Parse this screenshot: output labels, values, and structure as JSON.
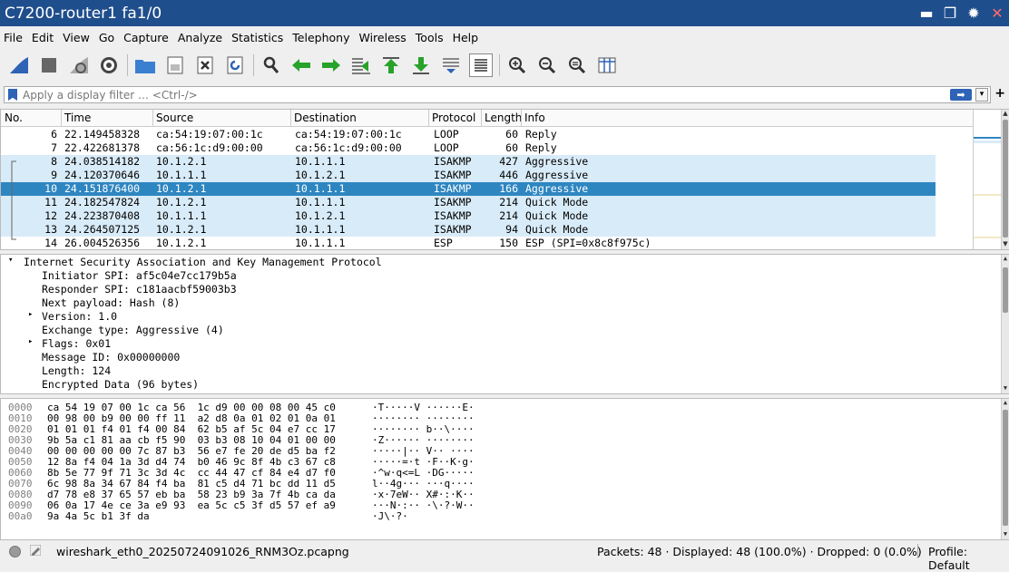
{
  "window": {
    "title": "C7200-router1 fa1/0"
  },
  "menu": [
    "File",
    "Edit",
    "View",
    "Go",
    "Capture",
    "Analyze",
    "Statistics",
    "Telephony",
    "Wireless",
    "Tools",
    "Help"
  ],
  "filter": {
    "placeholder": "Apply a display filter … <Ctrl-/>"
  },
  "columns": [
    "No.",
    "Time",
    "Source",
    "Destination",
    "Protocol",
    "Length",
    "Info"
  ],
  "packets": [
    {
      "no": "6",
      "time": "22.149458328",
      "src": "ca:54:19:07:00:1c",
      "dst": "ca:54:19:07:00:1c",
      "proto": "LOOP",
      "len": "60",
      "info": "Reply",
      "state": ""
    },
    {
      "no": "7",
      "time": "22.422681378",
      "src": "ca:56:1c:d9:00:00",
      "dst": "ca:56:1c:d9:00:00",
      "proto": "LOOP",
      "len": "60",
      "info": "Reply",
      "state": ""
    },
    {
      "no": "8",
      "time": "24.038514182",
      "src": "10.1.2.1",
      "dst": "10.1.1.1",
      "proto": "ISAKMP",
      "len": "427",
      "info": "Aggressive",
      "state": "rel"
    },
    {
      "no": "9",
      "time": "24.120370646",
      "src": "10.1.1.1",
      "dst": "10.1.2.1",
      "proto": "ISAKMP",
      "len": "446",
      "info": "Aggressive",
      "state": "rel"
    },
    {
      "no": "10",
      "time": "24.151876400",
      "src": "10.1.2.1",
      "dst": "10.1.1.1",
      "proto": "ISAKMP",
      "len": "166",
      "info": "Aggressive",
      "state": "sel"
    },
    {
      "no": "11",
      "time": "24.182547824",
      "src": "10.1.2.1",
      "dst": "10.1.1.1",
      "proto": "ISAKMP",
      "len": "214",
      "info": "Quick Mode",
      "state": "rel"
    },
    {
      "no": "12",
      "time": "24.223870408",
      "src": "10.1.1.1",
      "dst": "10.1.2.1",
      "proto": "ISAKMP",
      "len": "214",
      "info": "Quick Mode",
      "state": "rel"
    },
    {
      "no": "13",
      "time": "24.264507125",
      "src": "10.1.2.1",
      "dst": "10.1.1.1",
      "proto": "ISAKMP",
      "len": "94",
      "info": "Quick Mode",
      "state": "rel"
    },
    {
      "no": "14",
      "time": "26.004526356",
      "src": "10.1.2.1",
      "dst": "10.1.1.1",
      "proto": "ESP",
      "len": "150",
      "info": "ESP (SPI=0x8c8f975c)",
      "state": ""
    }
  ],
  "details": [
    {
      "text": "Internet Security Association and Key Management Protocol",
      "indent": 0,
      "expander": "▾"
    },
    {
      "text": "Initiator SPI: af5c04e7cc179b5a",
      "indent": 1,
      "expander": ""
    },
    {
      "text": "Responder SPI: c181aacbf59003b3",
      "indent": 1,
      "expander": ""
    },
    {
      "text": "Next payload: Hash (8)",
      "indent": 1,
      "expander": ""
    },
    {
      "text": "Version: 1.0",
      "indent": 1,
      "expander": "▸"
    },
    {
      "text": "Exchange type: Aggressive (4)",
      "indent": 1,
      "expander": ""
    },
    {
      "text": "Flags: 0x01",
      "indent": 1,
      "expander": "▸"
    },
    {
      "text": "Message ID: 0x00000000",
      "indent": 1,
      "expander": ""
    },
    {
      "text": "Length: 124",
      "indent": 1,
      "expander": ""
    },
    {
      "text": "Encrypted Data (96 bytes)",
      "indent": 1,
      "expander": ""
    }
  ],
  "bytes": [
    {
      "off": "0000",
      "hex": "ca 54 19 07 00 1c ca 56  1c d9 00 00 08 00 45 c0",
      "ascii": "·T·····V ······E·"
    },
    {
      "off": "0010",
      "hex": "00 98 00 b9 00 00 ff 11  a2 d8 0a 01 02 01 0a 01",
      "ascii": "········ ········"
    },
    {
      "off": "0020",
      "hex": "01 01 01 f4 01 f4 00 84  62 b5 af 5c 04 e7 cc 17",
      "ascii": "········ b··\\····"
    },
    {
      "off": "0030",
      "hex": "9b 5a c1 81 aa cb f5 90  03 b3 08 10 04 01 00 00",
      "ascii": "·Z······ ········"
    },
    {
      "off": "0040",
      "hex": "00 00 00 00 00 7c 87 b3  56 e7 fe 20 de d5 ba f2",
      "ascii": "·····|·· V·· ····"
    },
    {
      "off": "0050",
      "hex": "12 8a f4 04 1a 3d d4 74  b0 46 9c 8f 4b c3 67 c8",
      "ascii": "·····=·t ·F··K·g·"
    },
    {
      "off": "0060",
      "hex": "8b 5e 77 9f 71 3c 3d 4c  cc 44 47 cf 84 e4 d7 f0",
      "ascii": "·^w·q<=L ·DG·····"
    },
    {
      "off": "0070",
      "hex": "6c 98 8a 34 67 84 f4 ba  81 c5 d4 71 bc dd 11 d5",
      "ascii": "l··4g··· ···q····"
    },
    {
      "off": "0080",
      "hex": "d7 78 e8 37 65 57 eb ba  58 23 b9 3a 7f 4b ca da",
      "ascii": "·x·7eW·· X#·:·K··"
    },
    {
      "off": "0090",
      "hex": "06 0a 17 4e ce 3a e9 93  ea 5c c5 3f d5 57 ef a9",
      "ascii": "···N·:·· ·\\·?·W··"
    },
    {
      "off": "00a0",
      "hex": "9a 4a 5c b1 3f da",
      "ascii": "·J\\·?·"
    }
  ],
  "status": {
    "file": "wireshark_eth0_20250724091026_RNM3Oz.pcapng",
    "packets": "Packets: 48 · Displayed: 48 (100.0%) · Dropped: 0 (0.0%)",
    "profile": "Profile: Default"
  },
  "colors": {
    "title_bg": "#1f4e8c",
    "selected": "#2e86c1",
    "related": "#d8ebf8",
    "accent_blue": "#2e63b6",
    "green": "#27a22a"
  },
  "icons": [
    "shark-fin-start-icon",
    "stop-icon",
    "restart-icon",
    "options-gear-icon",
    "open-folder-icon",
    "save-file-icon",
    "close-file-icon",
    "reload-icon",
    "find-icon",
    "back-arrow-icon",
    "forward-arrow-icon",
    "go-to-packet-icon",
    "first-packet-icon",
    "last-packet-icon",
    "autoscroll-icon",
    "colorize-icon",
    "zoom-in-icon",
    "zoom-out-icon",
    "zoom-reset-icon",
    "resize-columns-icon"
  ]
}
